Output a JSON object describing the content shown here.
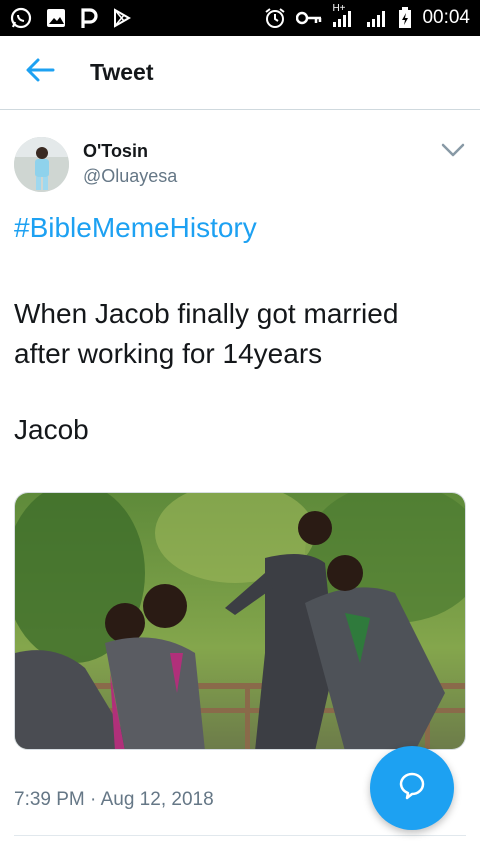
{
  "status_bar": {
    "network": "H+",
    "time": "00:04",
    "icons": [
      "whatsapp-icon",
      "gallery-icon",
      "p-app-icon",
      "play-store-icon",
      "alarm-icon",
      "key-icon",
      "signal-icon",
      "signal-icon",
      "battery-charging-icon"
    ]
  },
  "header": {
    "title": "Tweet",
    "back_icon": "arrow-left-icon"
  },
  "author": {
    "name": "O'Tosin",
    "handle": "@Oluayesa",
    "menu_icon": "chevron-down-icon"
  },
  "tweet": {
    "hashtag": "#BibleMemeHistory",
    "text_line1": "When Jacob finally got married",
    "text_line2": "after working for 14years",
    "text_line3": "Jacob",
    "timestamp": "7:39 PM · Aug 12, 2018"
  },
  "fab": {
    "icon": "reply-bubble-icon"
  },
  "colors": {
    "accent": "#1da1f2",
    "secondary_text": "#657786",
    "primary_text": "#14171a"
  }
}
